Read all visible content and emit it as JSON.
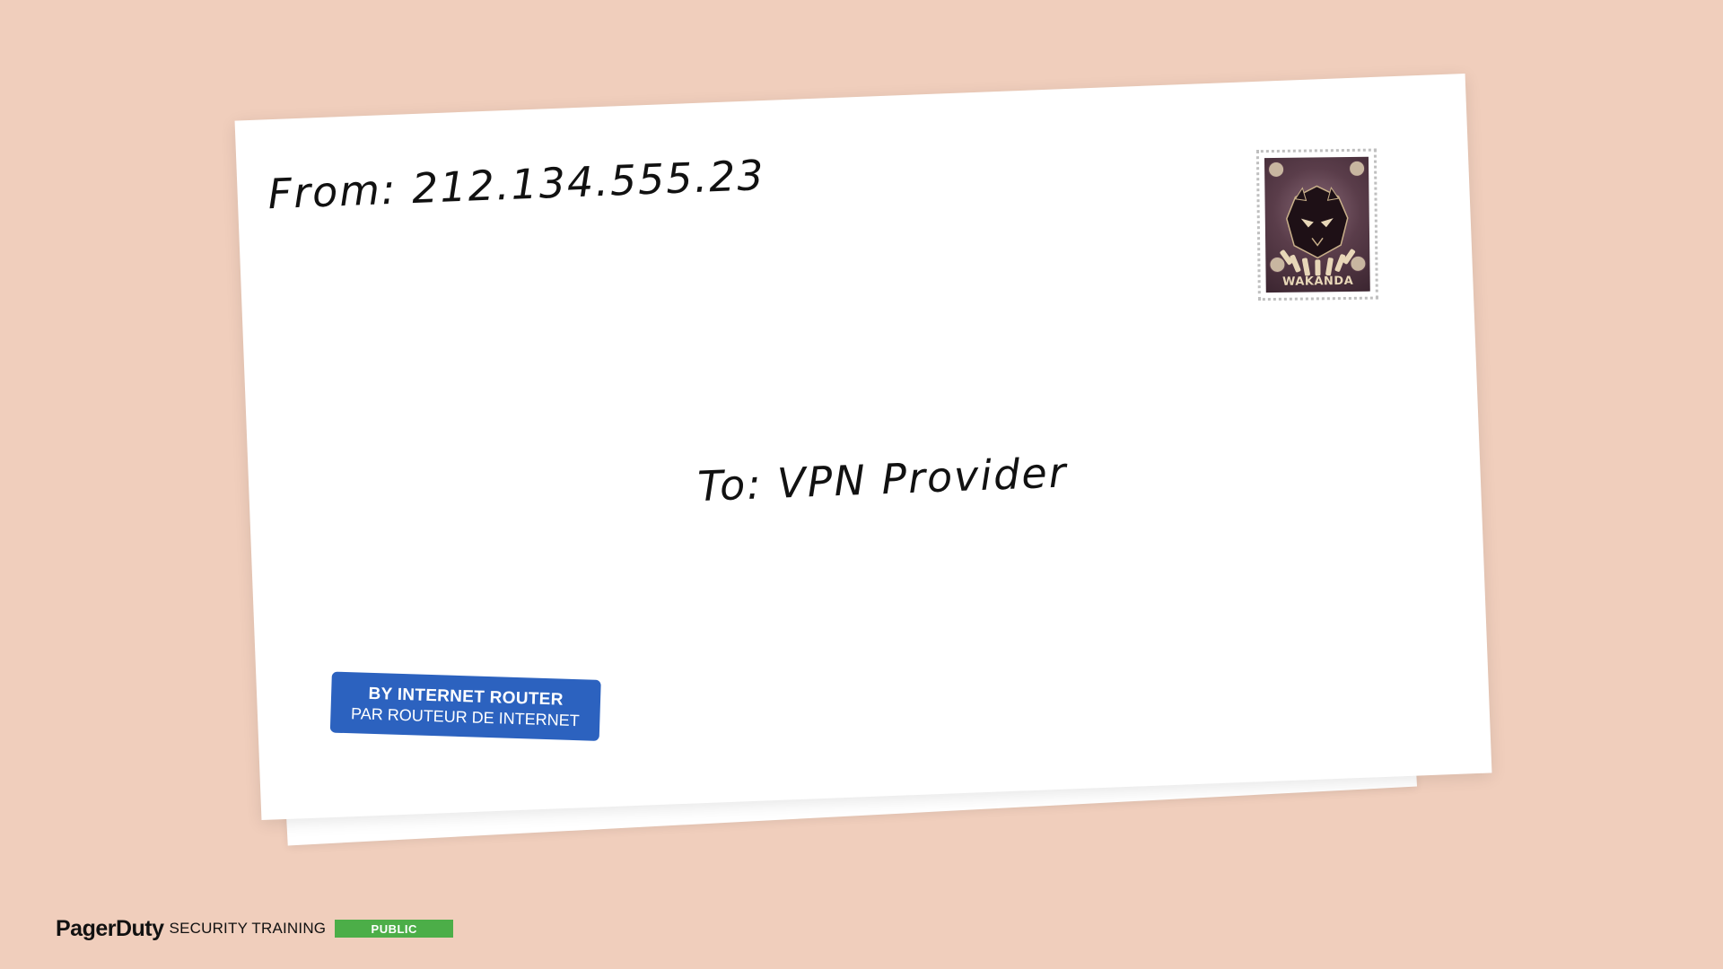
{
  "envelope": {
    "from_text": "From: 212.134.555.23",
    "to_text": "To: VPN Provider",
    "stamp": {
      "caption": "WAKANDA",
      "icon": "panther-mask-icon"
    },
    "airmail_label": {
      "line1": "BY INTERNET ROUTER",
      "line2": "PAR ROUTEUR DE INTERNET"
    },
    "stripe_colors": [
      "#E13B3B",
      "#2D63C0"
    ]
  },
  "footer": {
    "brand": "PagerDuty",
    "subtitle": "SECURITY TRAINING",
    "badge": "PUBLIC",
    "badge_color": "#4CAE48"
  },
  "colors": {
    "background": "#F0CEBC",
    "envelope": "#ffffff",
    "label": "#2C62BF"
  }
}
